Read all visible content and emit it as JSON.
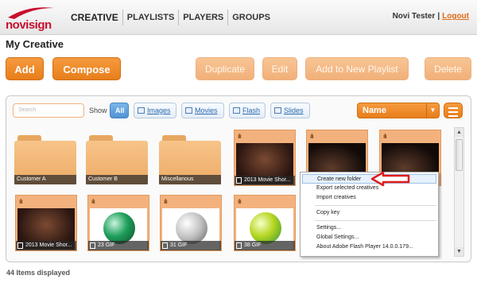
{
  "brand": {
    "logo_text": "novisign",
    "logo_red": "#c8102e"
  },
  "nav": {
    "items": [
      "CREATIVE",
      "PLAYLISTS",
      "PLAYERS",
      "GROUPS"
    ],
    "active": "CREATIVE"
  },
  "user": {
    "name": "Novi Tester",
    "separator": "|",
    "logout": "Logout"
  },
  "page": {
    "title": "My Creative"
  },
  "toolbar": {
    "add": "Add",
    "compose": "Compose",
    "duplicate": "Duplicate",
    "edit": "Edit",
    "add_to_playlist": "Add to New Playlist",
    "delete": "Delete",
    "accent": "#e87e1b",
    "disabled": "#f3b581"
  },
  "filters": {
    "search_placeholder": "Search",
    "show_label": "Show",
    "all": "All",
    "images": "Images",
    "movies": "Movies",
    "flash": "Flash",
    "slides": "Slides",
    "sort_value": "Name",
    "sort_caret": "▼"
  },
  "folders": [
    "Customer A",
    "Customer B",
    "Miscellanous"
  ],
  "tiles": [
    {
      "label": "2013 Movie Shor...",
      "kind": "movie"
    },
    {
      "label": "",
      "kind": "movie"
    },
    {
      "label": "",
      "kind": "movie"
    },
    {
      "label": "2013 Movie Shor...",
      "kind": "movie"
    },
    {
      "label": "23 GIF",
      "kind": "gif",
      "color": "#1e9f5a"
    },
    {
      "label": "31 GIF",
      "kind": "gif",
      "color": "#bfbfbf"
    },
    {
      "label": "38 GIF",
      "kind": "gif",
      "color": "#b5d621"
    }
  ],
  "context_menu": {
    "items": [
      "Create new folder",
      "Export selected creatives",
      "Import creatives",
      "Copy key",
      "Settings...",
      "Global Settings...",
      "About Adobe Flash Player 14.0.0.179..."
    ]
  },
  "scrollbar": {
    "up": "▲",
    "down": "▼"
  },
  "status": {
    "text": "44 Items displayed"
  }
}
